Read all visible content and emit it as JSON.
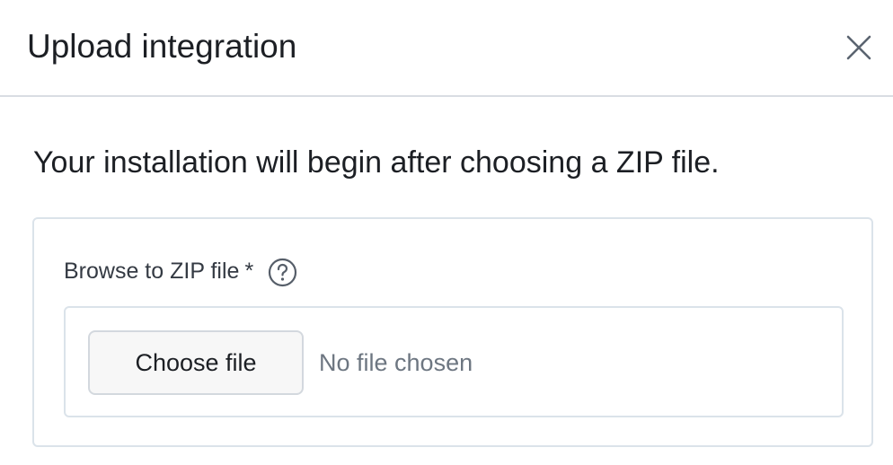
{
  "dialog": {
    "title": "Upload integration",
    "close_icon": "close-icon"
  },
  "intro_text": "Your installation will begin after choosing a ZIP file.",
  "field": {
    "label": "Browse to ZIP file",
    "required_marker": "*",
    "help_icon": "question-circle-icon",
    "choose_button_label": "Choose file",
    "status_text": "No file chosen"
  },
  "colors": {
    "text": "#1c1f24",
    "muted": "#6d7681",
    "border": "#dbe3ea",
    "button_bg": "#f7f7f7"
  }
}
